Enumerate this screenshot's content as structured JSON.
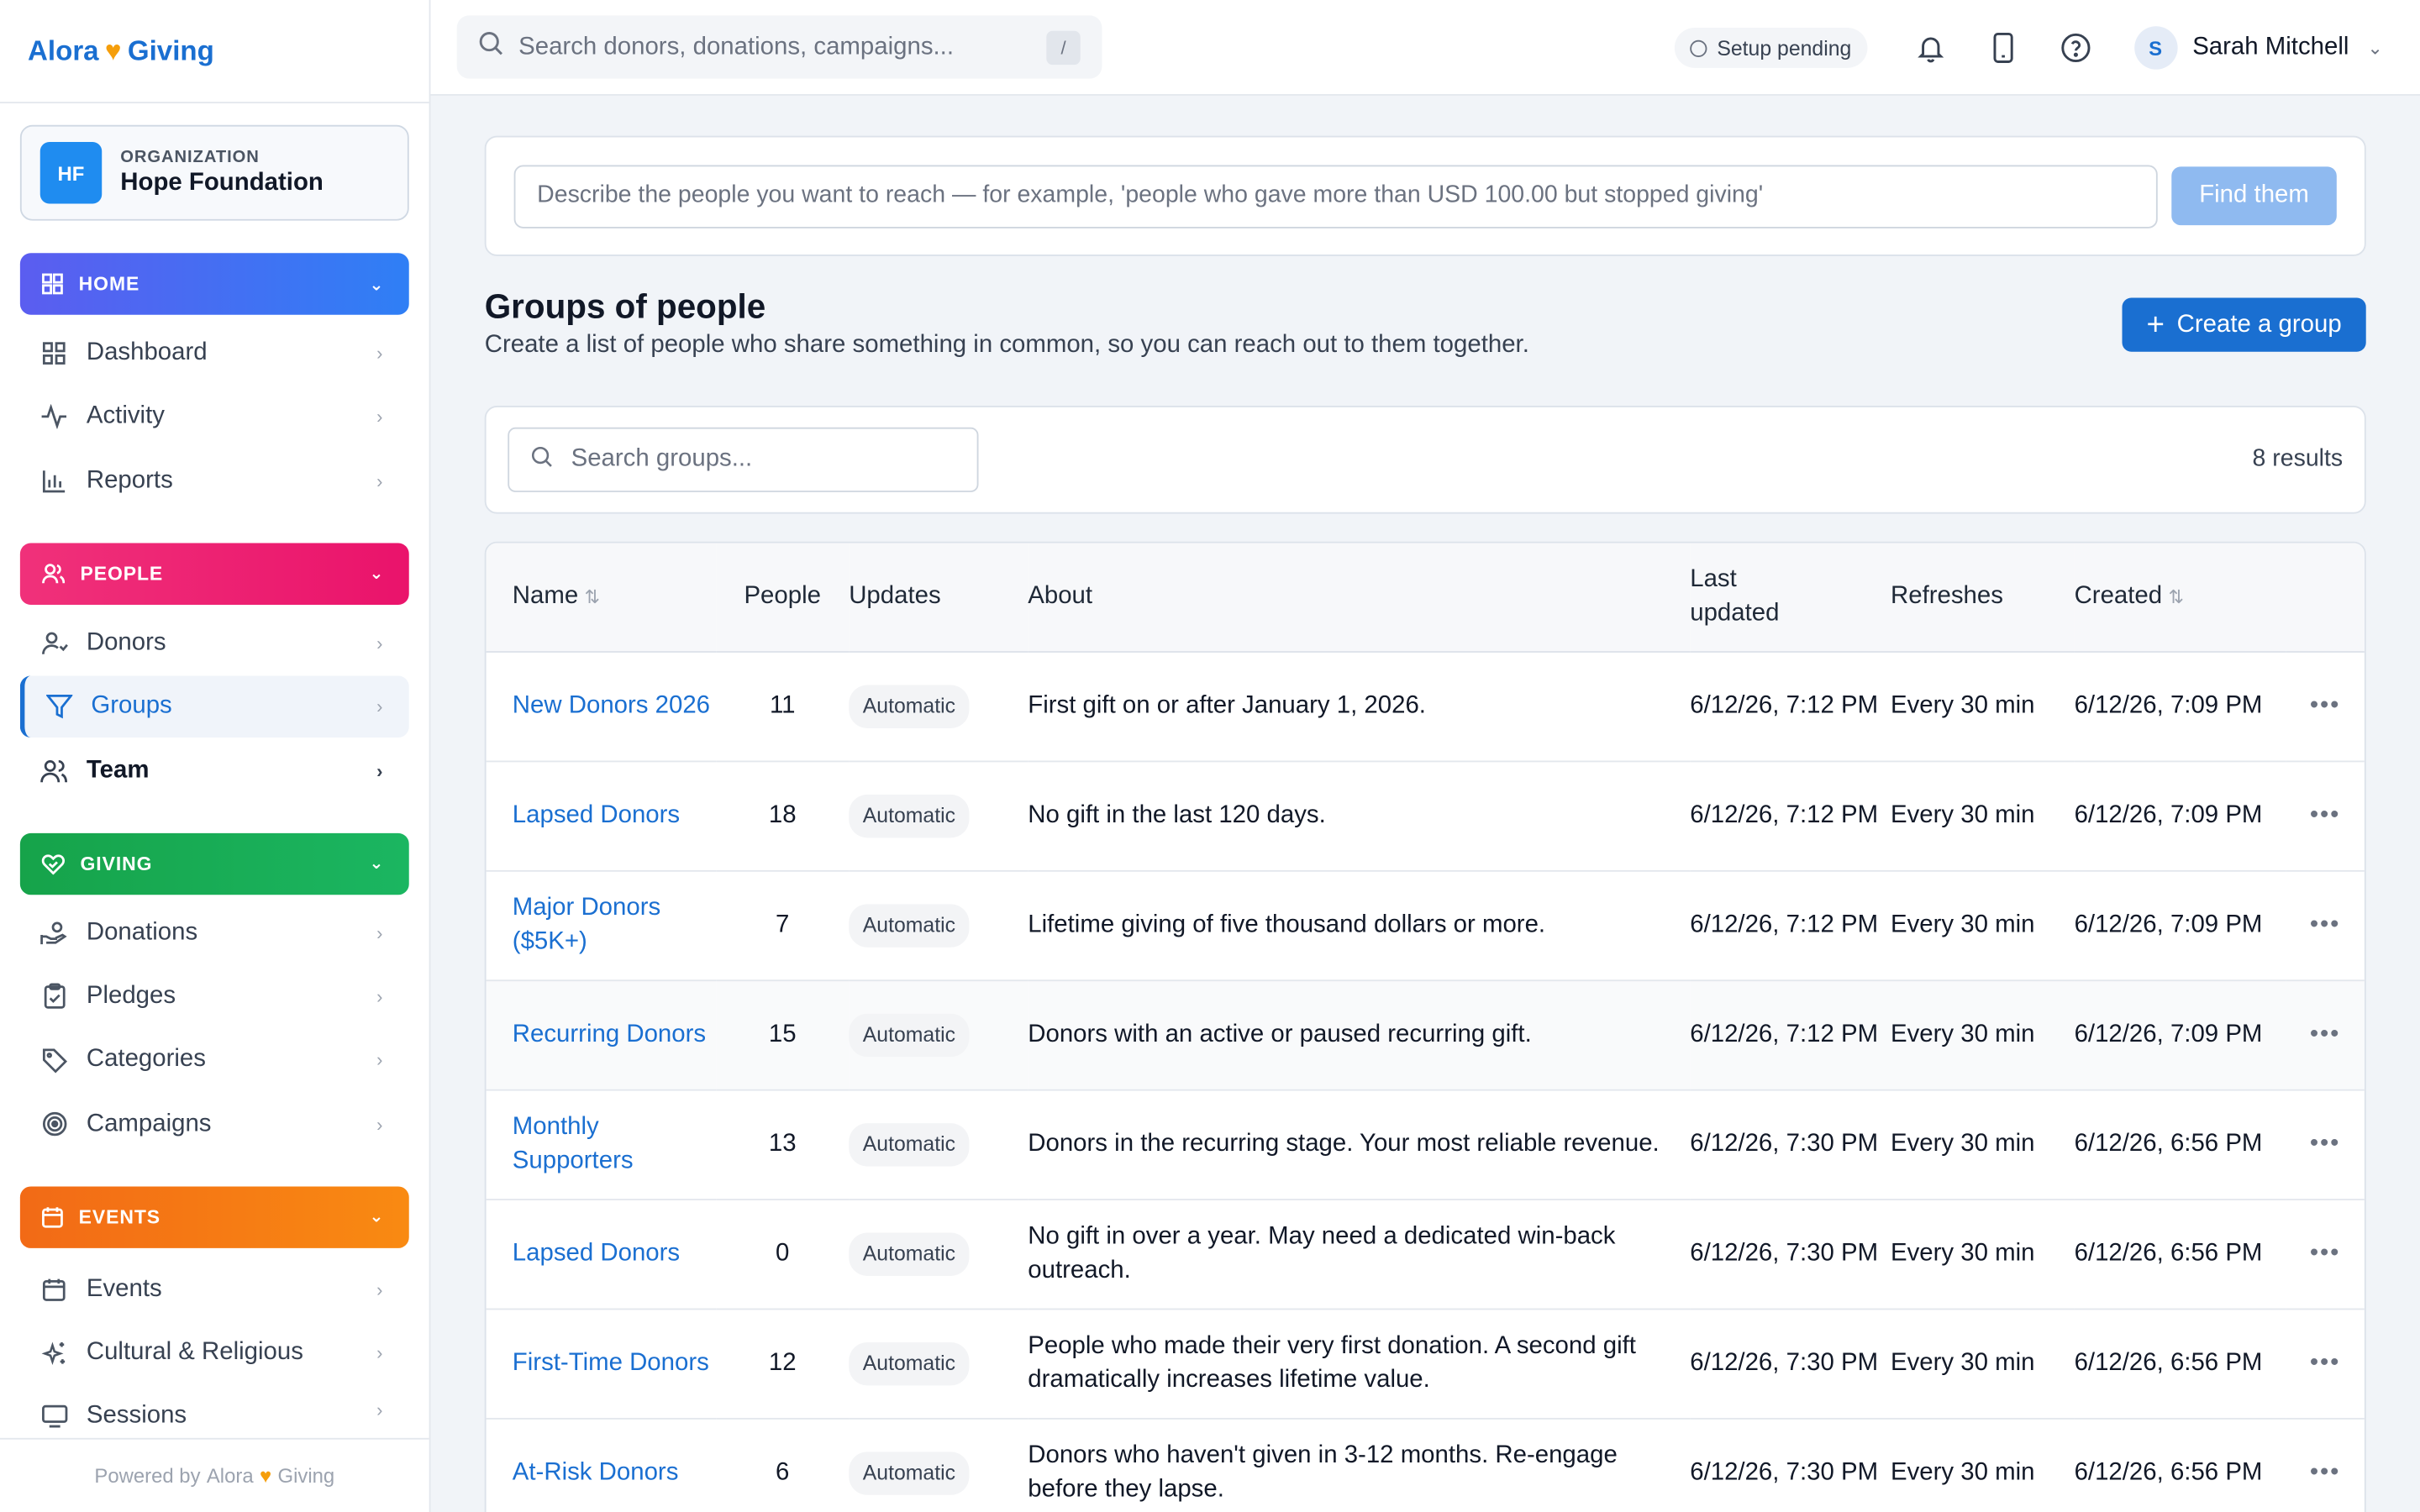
{
  "brand": {
    "name_left": "Alora",
    "name_right": "Giving"
  },
  "org": {
    "initials": "HF",
    "label": "ORGANIZATION",
    "name": "Hope Foundation"
  },
  "sidebar": {
    "home": {
      "label": "HOME",
      "items": [
        {
          "label": "Dashboard",
          "icon": "grid-icon"
        },
        {
          "label": "Activity",
          "icon": "activity-icon"
        },
        {
          "label": "Reports",
          "icon": "bar-chart-icon"
        }
      ]
    },
    "people": {
      "label": "PEOPLE",
      "items": [
        {
          "label": "Donors",
          "icon": "user-icon"
        },
        {
          "label": "Groups",
          "icon": "filter-icon"
        },
        {
          "label": "Team",
          "icon": "users-icon"
        }
      ]
    },
    "giving": {
      "label": "GIVING",
      "items": [
        {
          "label": "Donations",
          "icon": "hand-coin-icon"
        },
        {
          "label": "Pledges",
          "icon": "clipboard-icon"
        },
        {
          "label": "Categories",
          "icon": "tag-icon"
        },
        {
          "label": "Campaigns",
          "icon": "target-icon"
        }
      ]
    },
    "events": {
      "label": "EVENTS",
      "items": [
        {
          "label": "Events",
          "icon": "calendar-icon"
        },
        {
          "label": "Cultural & Religious",
          "icon": "sparkles-icon"
        },
        {
          "label": "Sessions",
          "icon": "monitor-icon"
        }
      ]
    },
    "footer": {
      "powered": "Powered by",
      "brand_left": "Alora",
      "brand_right": "Giving"
    }
  },
  "topbar": {
    "search_placeholder": "Search donors, donations, campaigns...",
    "search_shortcut": "/",
    "setup_status": "Setup pending",
    "user_initial": "S",
    "user_name": "Sarah Mitchell"
  },
  "find": {
    "placeholder": "Describe the people you want to reach — for example, 'people who gave more than USD 100.00 but stopped giving'",
    "button": "Find them"
  },
  "page": {
    "title": "Groups of people",
    "subtitle": "Create a list of people who share something in common, so you can reach out to them together.",
    "create_button": "Create a group",
    "groups_search_placeholder": "Search groups...",
    "results": "8 results"
  },
  "table": {
    "headers": {
      "name": "Name",
      "people": "People",
      "updates": "Updates",
      "about": "About",
      "last_updated": "Last updated",
      "refreshes": "Refreshes",
      "created": "Created"
    },
    "rows": [
      {
        "name": "New Donors 2026",
        "people": "11",
        "updates": "Automatic",
        "about": "First gift on or after January 1, 2026.",
        "last_updated": "6/12/26, 7:12 PM",
        "refreshes": "Every 30 min",
        "created": "6/12/26, 7:09 PM"
      },
      {
        "name": "Lapsed Donors",
        "people": "18",
        "updates": "Automatic",
        "about": "No gift in the last 120 days.",
        "last_updated": "6/12/26, 7:12 PM",
        "refreshes": "Every 30 min",
        "created": "6/12/26, 7:09 PM"
      },
      {
        "name": "Major Donors ($5K+)",
        "people": "7",
        "updates": "Automatic",
        "about": "Lifetime giving of five thousand dollars or more.",
        "last_updated": "6/12/26, 7:12 PM",
        "refreshes": "Every 30 min",
        "created": "6/12/26, 7:09 PM"
      },
      {
        "name": "Recurring Donors",
        "people": "15",
        "updates": "Automatic",
        "about": "Donors with an active or paused recurring gift.",
        "last_updated": "6/12/26, 7:12 PM",
        "refreshes": "Every 30 min",
        "created": "6/12/26, 7:09 PM"
      },
      {
        "name": "Monthly Supporters",
        "people": "13",
        "updates": "Automatic",
        "about": "Donors in the recurring stage. Your most reliable revenue.",
        "last_updated": "6/12/26, 7:30 PM",
        "refreshes": "Every 30 min",
        "created": "6/12/26, 6:56 PM"
      },
      {
        "name": "Lapsed Donors",
        "people": "0",
        "updates": "Automatic",
        "about": "No gift in over a year. May need a dedicated win-back outreach.",
        "last_updated": "6/12/26, 7:30 PM",
        "refreshes": "Every 30 min",
        "created": "6/12/26, 6:56 PM"
      },
      {
        "name": "First-Time Donors",
        "people": "12",
        "updates": "Automatic",
        "about": "People who made their very first donation. A second gift dramatically increases lifetime value.",
        "last_updated": "6/12/26, 7:30 PM",
        "refreshes": "Every 30 min",
        "created": "6/12/26, 6:56 PM"
      },
      {
        "name": "At-Risk Donors",
        "people": "6",
        "updates": "Automatic",
        "about": "Donors who haven't given in 3-12 months. Re-engage before they lapse.",
        "last_updated": "6/12/26, 7:30 PM",
        "refreshes": "Every 30 min",
        "created": "6/12/26, 6:56 PM"
      }
    ]
  },
  "colors": {
    "accent": "#1a6fd1",
    "home": "#3f6ff2",
    "people": "#ec1f70",
    "giving": "#16a34a",
    "events": "#f57a14",
    "brand_heart": "#f59e0b"
  }
}
